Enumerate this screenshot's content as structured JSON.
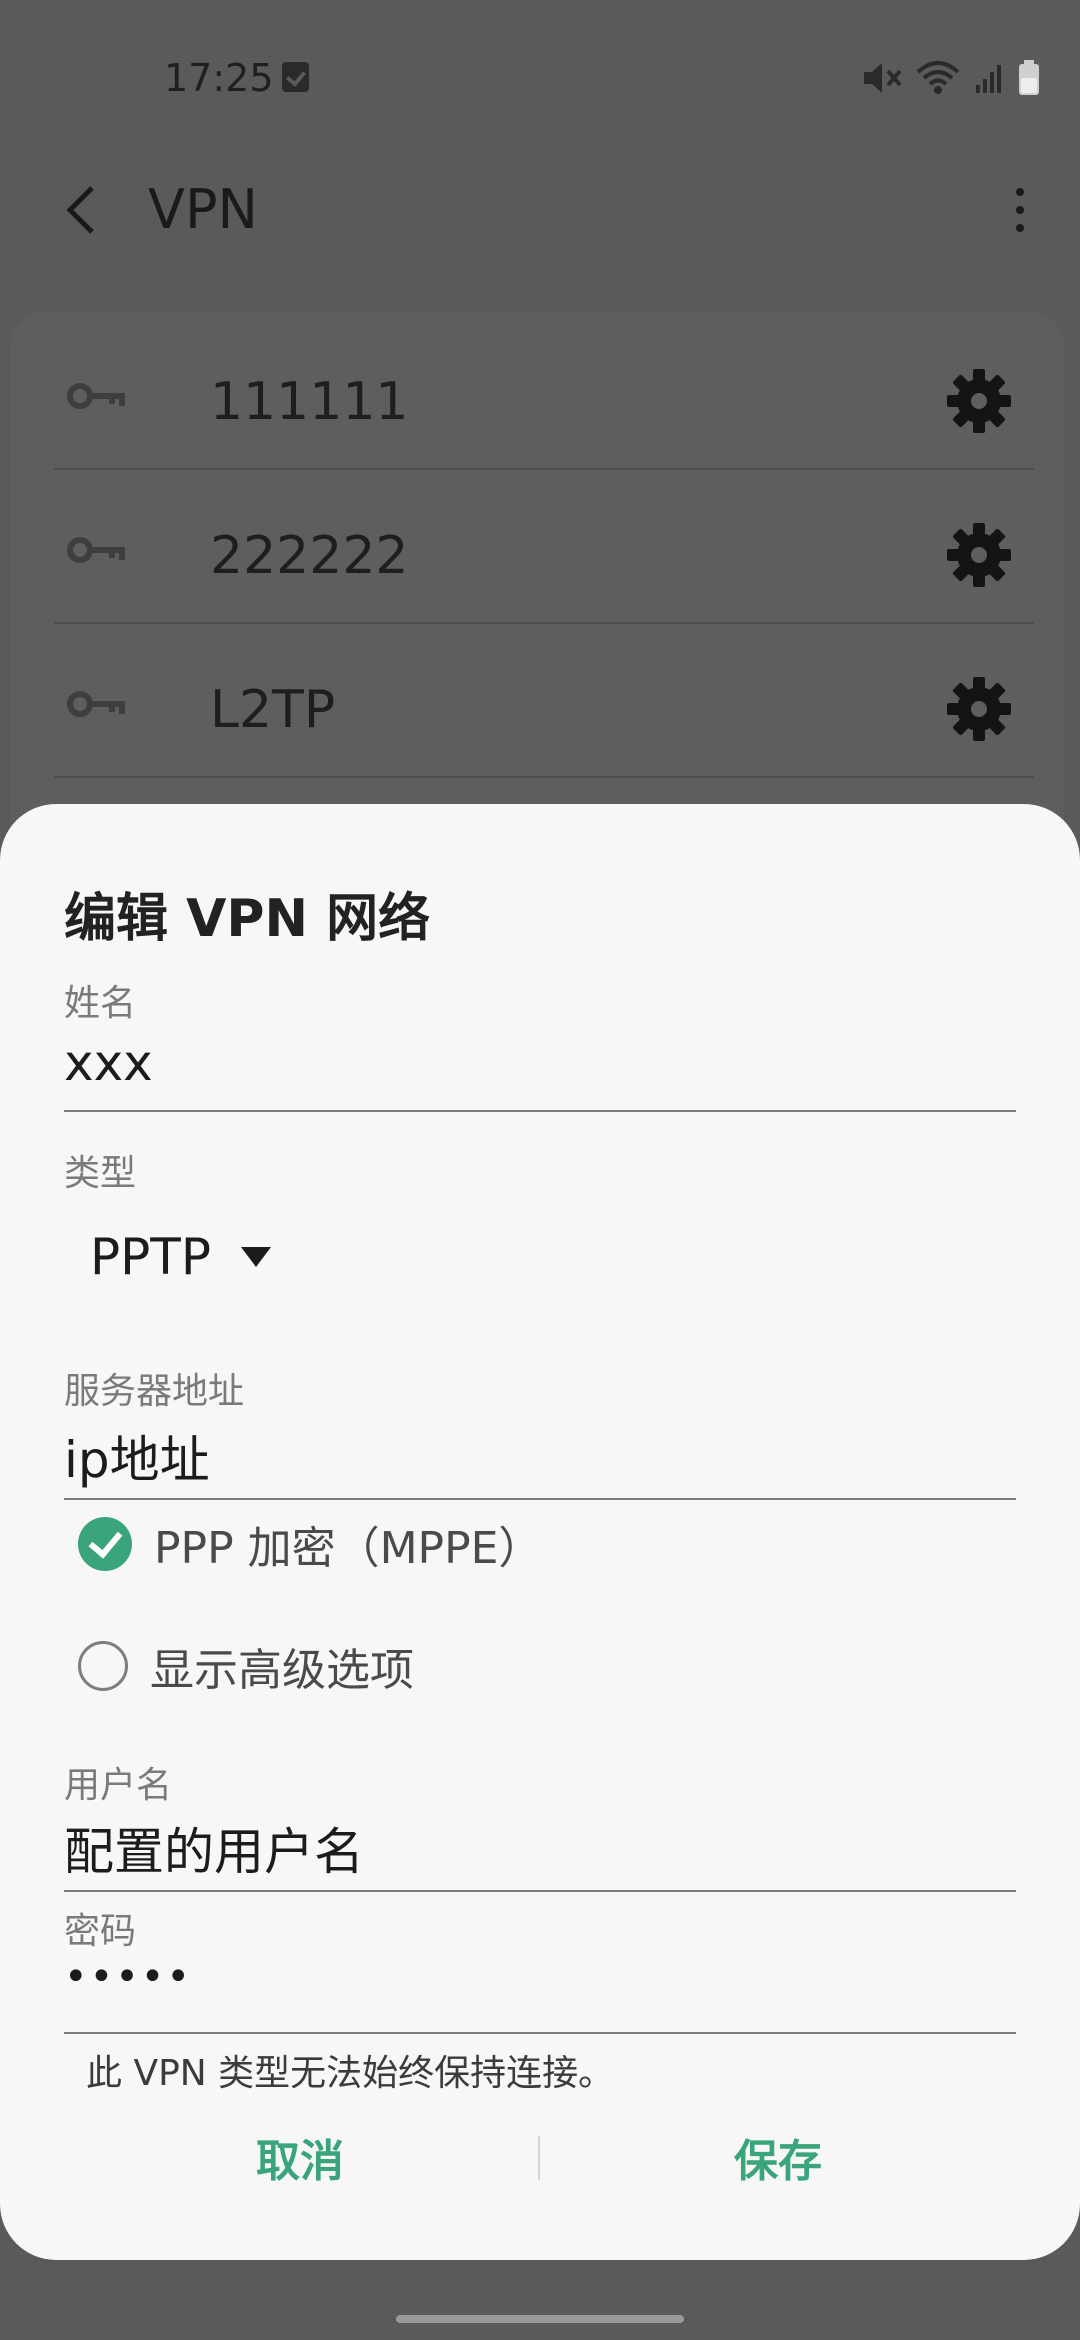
{
  "status_bar": {
    "time": "17:25",
    "icons": [
      "checkbox-notification-icon",
      "mute-icon",
      "wifi-icon",
      "signal-icon",
      "battery-icon"
    ]
  },
  "app_bar": {
    "title": "VPN",
    "back_icon": "chevron-left-icon",
    "more_icon": "more-vertical-icon"
  },
  "vpn_list": {
    "items": [
      {
        "label": "111111"
      },
      {
        "label": "222222"
      },
      {
        "label": "L2TP"
      }
    ]
  },
  "dialog": {
    "title": "编辑 VPN 网络",
    "name_label": "姓名",
    "name_value": "xxx",
    "type_label": "类型",
    "type_value": "PPTP",
    "server_label": "服务器地址",
    "server_value": "ip地址",
    "ppp_encryption_label": "PPP 加密（MPPE）",
    "ppp_encryption_checked": true,
    "show_advanced_label": "显示高级选项",
    "show_advanced_checked": false,
    "username_label": "用户名",
    "username_value": "配置的用户名",
    "password_label": "密码",
    "password_value": "•••••",
    "note": "此 VPN 类型无法始终保持连接。",
    "cancel_label": "取消",
    "save_label": "保存"
  },
  "colors": {
    "accent": "#3aa57a",
    "scrim": "#5a5a5a",
    "dialog_bg": "#f7f7f7"
  }
}
